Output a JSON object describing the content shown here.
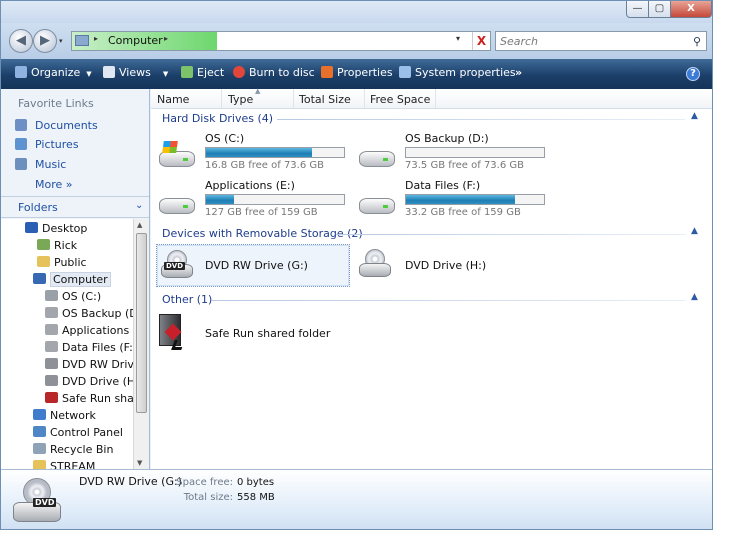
{
  "titlebar": {
    "minimize": "—",
    "maximize": "▢",
    "close": "X"
  },
  "address": {
    "path": "Computer",
    "arrow": "▸",
    "dropdown": "▾",
    "clear": "X",
    "back_glyph": "◀",
    "forward_glyph": "▶"
  },
  "search": {
    "placeholder": "Search"
  },
  "toolbar": {
    "organize": "Organize",
    "views": "Views",
    "eject": "Eject",
    "burn": "Burn to disc",
    "properties": "Properties",
    "system_properties": "System properties",
    "more": "»",
    "help": "?"
  },
  "navpane": {
    "favorites_title": "Favorite Links",
    "favorites": [
      {
        "label": "Documents",
        "icon": "documents-icon",
        "color": "#6e8fc5"
      },
      {
        "label": "Pictures",
        "icon": "pictures-icon",
        "color": "#5e93cf"
      },
      {
        "label": "Music",
        "icon": "music-icon",
        "color": "#6d8fbd"
      },
      {
        "label": "More »"
      }
    ],
    "folders_label": "Folders",
    "tree": [
      {
        "label": "Desktop",
        "icon": "desktop-icon",
        "color": "#2b5fb4"
      },
      {
        "label": "Rick",
        "icon": "user-folder-icon",
        "color": "#7aa856"
      },
      {
        "label": "Public",
        "icon": "folder-icon",
        "color": "#e6c35a"
      },
      {
        "label": "Computer",
        "icon": "computer-icon",
        "color": "#3768b3"
      },
      {
        "label": "OS (C:)",
        "icon": "hard-drive-windows-icon",
        "color": "#9aa0a8"
      },
      {
        "label": "OS Backup (D:)",
        "icon": "hard-drive-icon",
        "color": "#a3a7ad"
      },
      {
        "label": "Applications (E:)",
        "icon": "hard-drive-icon",
        "color": "#a3a7ad"
      },
      {
        "label": "Data Files (F:)",
        "icon": "hard-drive-icon",
        "color": "#a3a7ad"
      },
      {
        "label": "DVD RW Drive (G:)",
        "icon": "dvd-drive-icon",
        "color": "#8e9298"
      },
      {
        "label": "DVD Drive (H:)",
        "icon": "dvd-drive-icon",
        "color": "#8e9298"
      },
      {
        "label": "Safe Run shared folder",
        "icon": "shared-folder-icon",
        "color": "#b8282a"
      },
      {
        "label": "Network",
        "icon": "network-icon",
        "color": "#3f7ccb"
      },
      {
        "label": "Control Panel",
        "icon": "control-panel-icon",
        "color": "#4f86c6"
      },
      {
        "label": "Recycle Bin",
        "icon": "recycle-bin-icon",
        "color": "#8fa3b8"
      },
      {
        "label": "STREAM",
        "icon": "folder-icon",
        "color": "#e6c35a"
      }
    ]
  },
  "columns": [
    "Name",
    "Type",
    "Total Size",
    "Free Space"
  ],
  "groups": {
    "hdd": "Hard Disk Drives (4)",
    "removable": "Devices with Removable Storage (2)",
    "other": "Other (1)"
  },
  "drives": [
    {
      "name": "OS (C:)",
      "free_text": "16.8 GB free of 73.6 GB",
      "used_fraction": 0.77
    },
    {
      "name": "OS Backup (D:)",
      "free_text": "73.5 GB free of 73.6 GB",
      "used_fraction": 0.0
    },
    {
      "name": "Applications (E:)",
      "free_text": "127 GB free of 159 GB",
      "used_fraction": 0.2
    },
    {
      "name": "Data Files (F:)",
      "free_text": "33.2 GB free of 159 GB",
      "used_fraction": 0.79
    }
  ],
  "removable": [
    {
      "name": "DVD RW Drive (G:)",
      "tag": "DVD"
    },
    {
      "name": "DVD Drive (H:)"
    }
  ],
  "other": [
    {
      "name": "Safe Run shared folder"
    }
  ],
  "details": {
    "name": "DVD RW Drive (G:)",
    "tag": "DVD",
    "space_free_label": "Space free:",
    "space_free": "0 bytes",
    "total_size_label": "Total size:",
    "total_size": "558 MB"
  }
}
